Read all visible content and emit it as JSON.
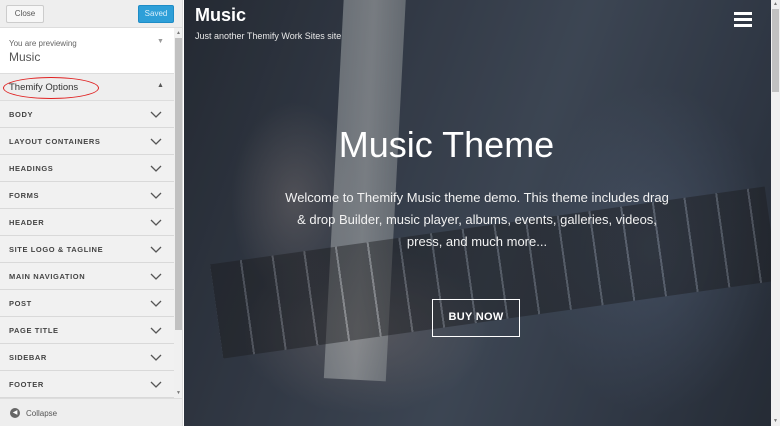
{
  "sidebar": {
    "close_label": "Close",
    "saved_label": "Saved",
    "preview_caption": "You are previewing",
    "preview_title": "Music",
    "section_title": "Themify Options",
    "items": [
      {
        "label": "BODY"
      },
      {
        "label": "LAYOUT CONTAINERS"
      },
      {
        "label": "HEADINGS"
      },
      {
        "label": "FORMS"
      },
      {
        "label": "HEADER"
      },
      {
        "label": "SITE LOGO & TAGLINE"
      },
      {
        "label": "MAIN NAVIGATION"
      },
      {
        "label": "POST"
      },
      {
        "label": "PAGE TITLE"
      },
      {
        "label": "SIDEBAR"
      },
      {
        "label": "FOOTER"
      }
    ],
    "collapse_label": "Collapse"
  },
  "site": {
    "title": "Music",
    "tagline": "Just another Themify Work Sites site"
  },
  "hero": {
    "title": "Music Theme",
    "text": "Welcome to Themify Music theme demo. This theme includes drag & drop Builder, music player, albums, events, galleries, videos, press, and much more...",
    "button_label": "BUY NOW"
  },
  "colors": {
    "accent": "#2e9fd8",
    "highlight_ring": "#e02020"
  },
  "icons": {
    "menu": "hamburger-icon",
    "collapse": "collapse-icon",
    "chevron": "chevron-down-icon"
  }
}
